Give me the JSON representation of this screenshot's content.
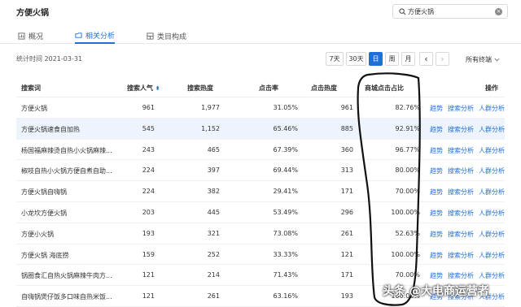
{
  "header": {
    "title": "方便火锅"
  },
  "search": {
    "value": "方便火锅"
  },
  "tabs": [
    {
      "label": "概况",
      "icon": "chart-bar-icon"
    },
    {
      "label": "相关分析",
      "icon": "folder-icon"
    },
    {
      "label": "类目构成",
      "icon": "grid-icon"
    }
  ],
  "toolbar": {
    "stat_time": "统计时间 2021-03-31",
    "btn_7d": "7天",
    "btn_30d": "30天",
    "btn_day": "日",
    "btn_week": "周",
    "btn_month": "月",
    "prev": "‹",
    "next": "›",
    "terminal": "所有终端"
  },
  "table": {
    "headers": {
      "keyword": "搜索词",
      "popularity": "搜索人气",
      "heat": "搜索热度",
      "ctr": "点击率",
      "click_heat": "点击热度",
      "mall_share": "商城点击占比",
      "ops": "操作"
    },
    "op_labels": {
      "trend": "趋势",
      "search": "搜索分析",
      "crowd": "人群分析"
    },
    "rows": [
      {
        "keyword": "方便火锅",
        "popularity": "961",
        "heat": "1,977",
        "ctr": "31.05%",
        "click_heat": "961",
        "mall_share": "82.76%"
      },
      {
        "keyword": "方便火锅速食自加热",
        "popularity": "545",
        "heat": "1,152",
        "ctr": "65.46%",
        "click_heat": "885",
        "mall_share": "92.91%"
      },
      {
        "keyword": "杨国福麻辣烫自热小火锅麻辣...",
        "popularity": "243",
        "heat": "465",
        "ctr": "67.39%",
        "click_heat": "360",
        "mall_share": "96.77%"
      },
      {
        "keyword": "椒吱自热小火锅方便自煮自助...",
        "popularity": "224",
        "heat": "397",
        "ctr": "69.44%",
        "click_heat": "313",
        "mall_share": "80.00%"
      },
      {
        "keyword": "方便火锅自嗨锅",
        "popularity": "224",
        "heat": "382",
        "ctr": "29.41%",
        "click_heat": "171",
        "mall_share": "70.00%"
      },
      {
        "keyword": "小龙坎方便火锅",
        "popularity": "203",
        "heat": "445",
        "ctr": "53.49%",
        "click_heat": "296",
        "mall_share": "100.00%"
      },
      {
        "keyword": "方便小火锅",
        "popularity": "193",
        "heat": "321",
        "ctr": "73.08%",
        "click_heat": "261",
        "mall_share": "52.63%"
      },
      {
        "keyword": "方便火锅 海底捞",
        "popularity": "159",
        "heat": "252",
        "ctr": "33.33%",
        "click_heat": "121",
        "mall_share": "100.00%"
      },
      {
        "keyword": "锅圈食汇自热火锅麻辣牛肉方...",
        "popularity": "121",
        "heat": "214",
        "ctr": "71.43%",
        "click_heat": "171",
        "mall_share": "70.00%"
      },
      {
        "keyword": "自嗨锅煲仔饭多口味自热米饭...",
        "popularity": "121",
        "heat": "261",
        "ctr": "63.16%",
        "click_heat": "193",
        "mall_share": "100.00%"
      }
    ]
  },
  "watermark": "头条 @大电商运营者"
}
